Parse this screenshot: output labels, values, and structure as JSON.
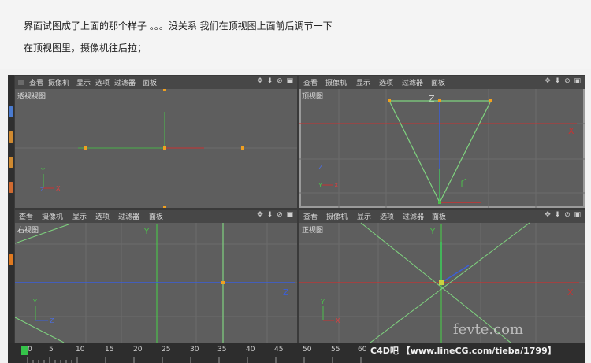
{
  "caption": {
    "line1": "界面试图成了上面的那个样子 。。。没关系  我们在顶视图上面前后调节一下",
    "line2": "在顶视图里，摄像机往后拉；"
  },
  "menu": [
    "查看",
    "摄像机",
    "显示",
    "选项",
    "过滤器",
    "面板"
  ],
  "nav_icons": "✥ ⬇ ⊘ ▣",
  "viewports": {
    "perspective": {
      "label": "透视视图"
    },
    "top": {
      "label": "顶视图",
      "axis_z": "Z",
      "axis_x": "X"
    },
    "right": {
      "label": "右视图",
      "axis_y": "Y",
      "axis_z": "Z"
    },
    "front": {
      "label": "正视图",
      "axis_y": "Y",
      "axis_x": "X"
    }
  },
  "axes_gizmo": {
    "y": "Y",
    "x": "X",
    "z": "Z"
  },
  "timeline": {
    "frames": [
      "0",
      "5",
      "10",
      "15",
      "20",
      "25",
      "30",
      "35",
      "40",
      "45",
      "50",
      "55",
      "60"
    ],
    "watermark": "C4D吧 【www.lineCG.com/tieba/1799】"
  },
  "watermark2": "fevte.com",
  "colors": {
    "grid": "#6c6c6c",
    "x_axis": "#c83232",
    "y_axis": "#4cc04c",
    "z_axis": "#3b5fd9",
    "camera_lines": "#7fd37f",
    "handle": "#f0a020"
  }
}
